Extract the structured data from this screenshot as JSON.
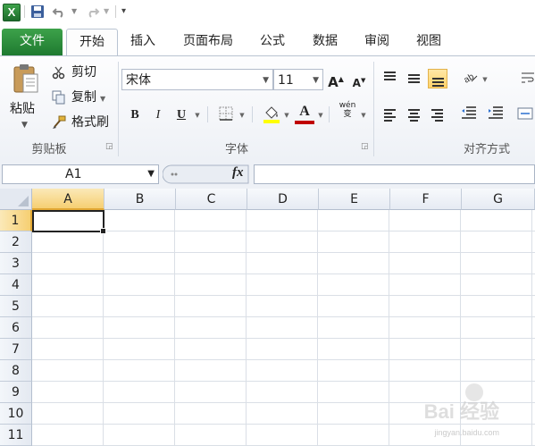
{
  "app_icon_label": "X",
  "tabs": [
    "文件",
    "开始",
    "插入",
    "页面布局",
    "公式",
    "数据",
    "审阅",
    "视图"
  ],
  "clipboard": {
    "paste_label": "粘贴",
    "cut_label": "剪切",
    "copy_label": "复制",
    "format_painter_label": "格式刷",
    "group_label": "剪贴板"
  },
  "font": {
    "name": "宋体",
    "size": "11",
    "grow_label": "A",
    "shrink_label": "A",
    "bold_label": "B",
    "italic_label": "I",
    "underline_label": "U",
    "font_color_label": "A",
    "phonetic_label": "wén 变",
    "group_label": "字体",
    "font_color": "#c00000",
    "fill_color": "#ffff00"
  },
  "alignment": {
    "group_label": "对齐方式"
  },
  "formula_bar": {
    "name_box": "A1",
    "fx_label": "fx",
    "formula": ""
  },
  "sheet": {
    "columns": [
      "A",
      "B",
      "C",
      "D",
      "E",
      "F",
      "G"
    ],
    "rows": [
      "1",
      "2",
      "3",
      "4",
      "5",
      "6",
      "7",
      "8",
      "9",
      "10",
      "11"
    ],
    "selected_cell": "A1"
  },
  "watermark": {
    "text": "Bai 经验",
    "sub": "jingyan.baidu.com"
  }
}
